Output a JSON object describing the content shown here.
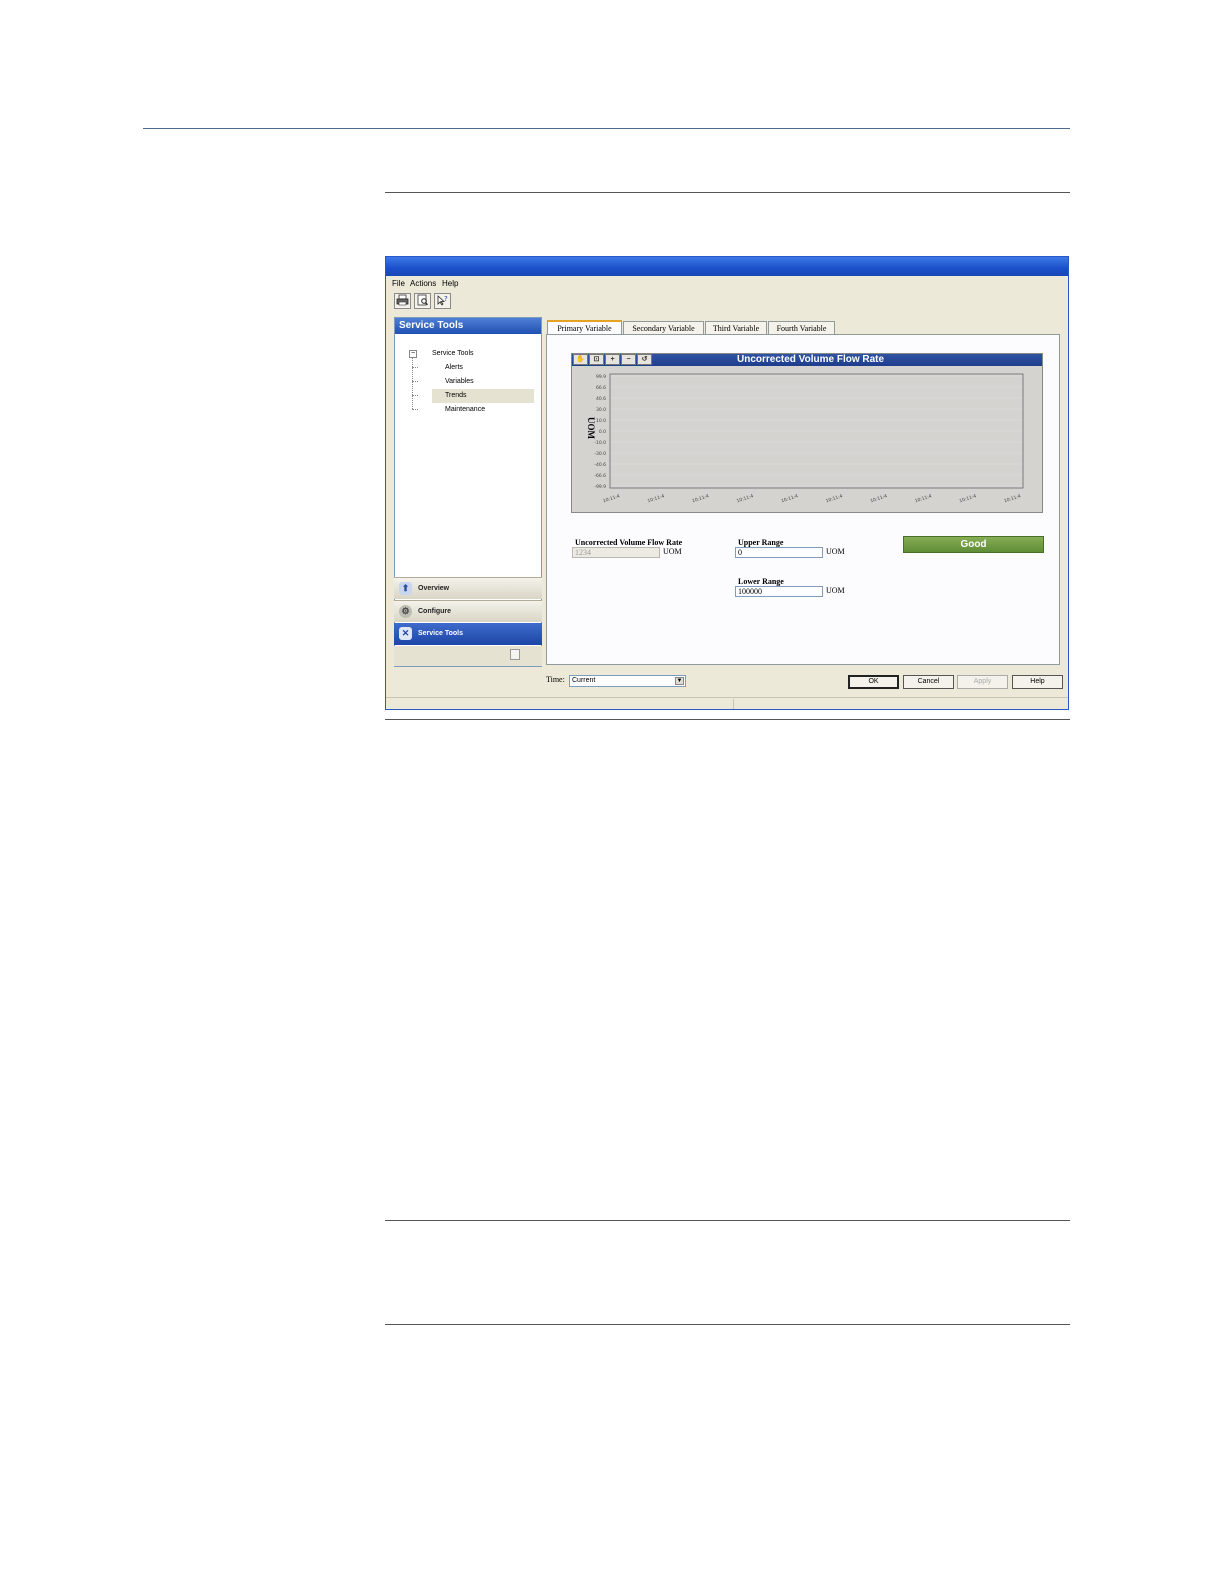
{
  "window": {
    "title": "",
    "menu": [
      "File",
      "Actions",
      "Help"
    ],
    "toolbar_icons": [
      "print-icon",
      "print-preview-icon",
      "help-context-icon"
    ]
  },
  "nav": {
    "header": "Service Tools",
    "tree": {
      "root": "Service Tools",
      "expand_glyph": "−",
      "children": [
        "Alerts",
        "Variables",
        "Trends",
        "Maintenance"
      ],
      "selected": "Trends"
    },
    "buttons": [
      {
        "label": "Overview",
        "icon": "overview-icon"
      },
      {
        "label": "Configure",
        "icon": "configure-icon"
      },
      {
        "label": "Service Tools",
        "icon": "service-tools-icon",
        "active": true
      }
    ]
  },
  "tabs": [
    "Primary Variable",
    "Secondary Variable",
    "Third Variable",
    "Fourth Variable"
  ],
  "active_tab": "Primary Variable",
  "chart_data": {
    "type": "line",
    "title": "Uncorrected Volume Flow Rate",
    "ylabel": "UOM",
    "xlabel": "",
    "y_ticks": [
      "99.9",
      "66.6",
      "40.6",
      "30.0",
      "10.0",
      "0.0",
      "-10.0",
      "-30.0",
      "-40.6",
      "-66.6",
      "-99.9"
    ],
    "x_ticks": [
      "10:11:4",
      "10:11:4",
      "10:11:4",
      "10:11:4",
      "10:11:4",
      "10:11:4",
      "10:11:4",
      "10:11:4",
      "10:11:4",
      "10:11:4"
    ],
    "series": [],
    "grid": true,
    "toolbar_icons": [
      "pan-icon",
      "zoom-box-icon",
      "zoom-in-icon",
      "zoom-out-icon",
      "reset-view-icon"
    ]
  },
  "fields": {
    "flow_rate": {
      "label": "Uncorrected Volume Flow Rate",
      "value": "1234",
      "unit": "UOM"
    },
    "upper_range": {
      "label": "Upper Range",
      "value": "0",
      "unit": "UOM"
    },
    "lower_range": {
      "label": "Lower Range",
      "value": "100000",
      "unit": "UOM"
    }
  },
  "status": {
    "text": "Good",
    "color": "#6e9a42"
  },
  "time": {
    "label": "Time:",
    "selected": "Current"
  },
  "dialog_buttons": {
    "ok": "OK",
    "cancel": "Cancel",
    "apply": "Apply",
    "help": "Help"
  }
}
